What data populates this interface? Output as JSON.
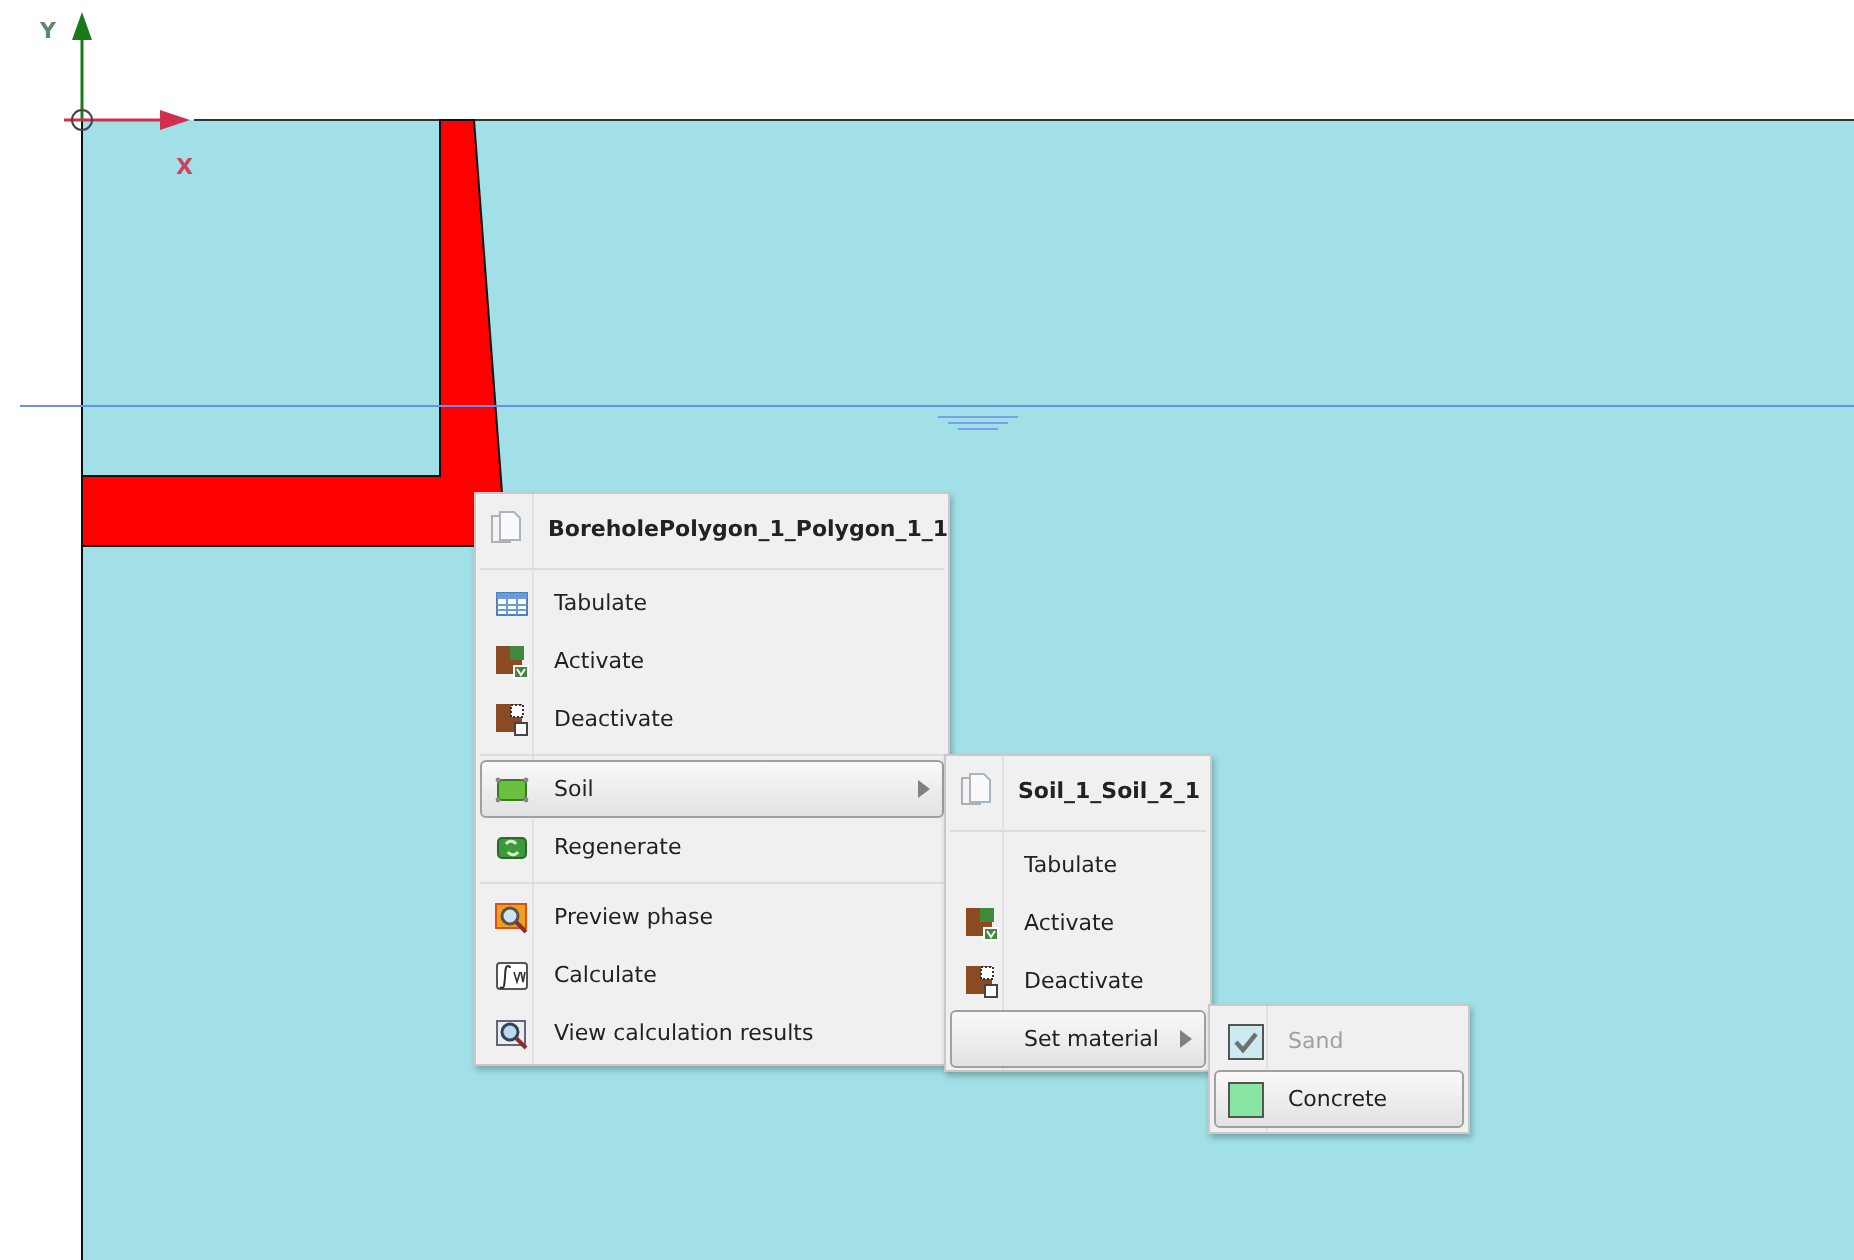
{
  "canvas": {
    "x_label": "X",
    "y_label": "Y"
  },
  "context_menu": {
    "title": "BoreholePolygon_1_Polygon_1_1",
    "groups": [
      [
        {
          "label": "Tabulate",
          "kind": "table",
          "selected": false,
          "has_submenu": false
        },
        {
          "label": "Activate",
          "kind": "activate",
          "selected": false,
          "has_submenu": false
        },
        {
          "label": "Deactivate",
          "kind": "deactivate",
          "selected": false,
          "has_submenu": false
        }
      ],
      [
        {
          "label": "Soil",
          "kind": "soil",
          "selected": true,
          "has_submenu": true
        },
        {
          "label": "Regenerate",
          "kind": "regenerate",
          "selected": false,
          "has_submenu": false
        }
      ],
      [
        {
          "label": "Preview phase",
          "kind": "preview",
          "selected": false,
          "has_submenu": false
        },
        {
          "label": "Calculate",
          "kind": "calculate",
          "selected": false,
          "has_submenu": false
        },
        {
          "label": "View calculation results",
          "kind": "results",
          "selected": false,
          "has_submenu": false
        }
      ]
    ]
  },
  "submenu": {
    "title": "Soil_1_Soil_2_1",
    "groups": [
      [
        {
          "label": "Tabulate",
          "kind": "plain",
          "selected": false,
          "has_submenu": false
        },
        {
          "label": "Activate",
          "kind": "activate",
          "selected": false,
          "has_submenu": false
        },
        {
          "label": "Deactivate",
          "kind": "deactivate",
          "selected": false,
          "has_submenu": false
        },
        {
          "label": "Set material",
          "kind": "plain",
          "selected": true,
          "has_submenu": true
        }
      ]
    ]
  },
  "material_menu": {
    "items": [
      {
        "label": "Sand",
        "color": "#cdeaf0",
        "checked": true,
        "disabled": true,
        "selected": false
      },
      {
        "label": "Concrete",
        "color": "#88e6a0",
        "checked": false,
        "disabled": false,
        "selected": true
      }
    ]
  }
}
